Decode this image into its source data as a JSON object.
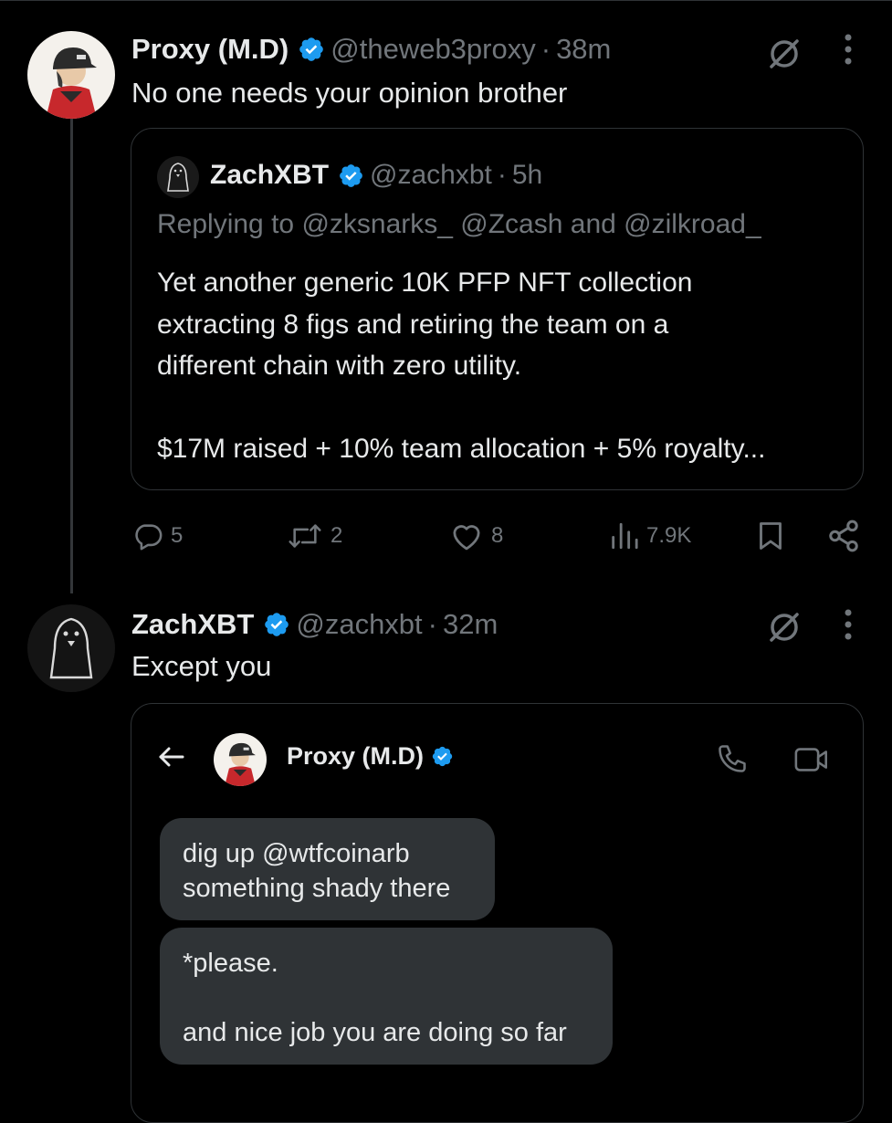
{
  "tweet1": {
    "name": "Proxy (M.D)",
    "handle": "@theweb3proxy",
    "separator": "·",
    "time": "38m",
    "text": "No one needs your opinion brother"
  },
  "quote": {
    "name": "ZachXBT",
    "handle": "@zachxbt",
    "separator": "·",
    "time": "5h",
    "replying_prefix": "Replying to",
    "replying_mentions": "@zksnarks_ @Zcash and @zilkroad_",
    "body_lines": [
      "Yet another generic 10K PFP NFT collection",
      "extracting 8 figs and retiring the team on a",
      "different chain with zero utility.",
      "",
      "$17M raised + 10% team allocation + 5% royalty..."
    ]
  },
  "actions": {
    "replies": "5",
    "reposts": "2",
    "likes": "8",
    "views": "7.9K"
  },
  "tweet2": {
    "name": "ZachXBT",
    "handle": "@zachxbt",
    "separator": "·",
    "time": "32m",
    "text": "Except you"
  },
  "dm": {
    "contact_name": "Proxy (M.D)",
    "bubble1_lines": [
      "dig up @wtfcoinarb",
      "something shady there"
    ],
    "bubble2_lines": [
      "*please.",
      "",
      "and nice job you are doing so far"
    ]
  },
  "colors": {
    "background": "#000000",
    "text": "#e7e9ea",
    "muted": "#71767b",
    "border": "#2f3336",
    "verified": "#1d9bf0",
    "bubble": "#2f3336"
  },
  "icons": {
    "grok": "grok-slash-circle-icon",
    "more": "more-vertical-icon",
    "reply": "reply-bubble-icon",
    "repost": "repost-icon",
    "like": "heart-icon",
    "views": "views-bars-icon",
    "bookmark": "bookmark-icon",
    "share": "share-icon",
    "back": "arrow-left-icon",
    "call": "phone-icon",
    "video": "video-camera-icon"
  }
}
